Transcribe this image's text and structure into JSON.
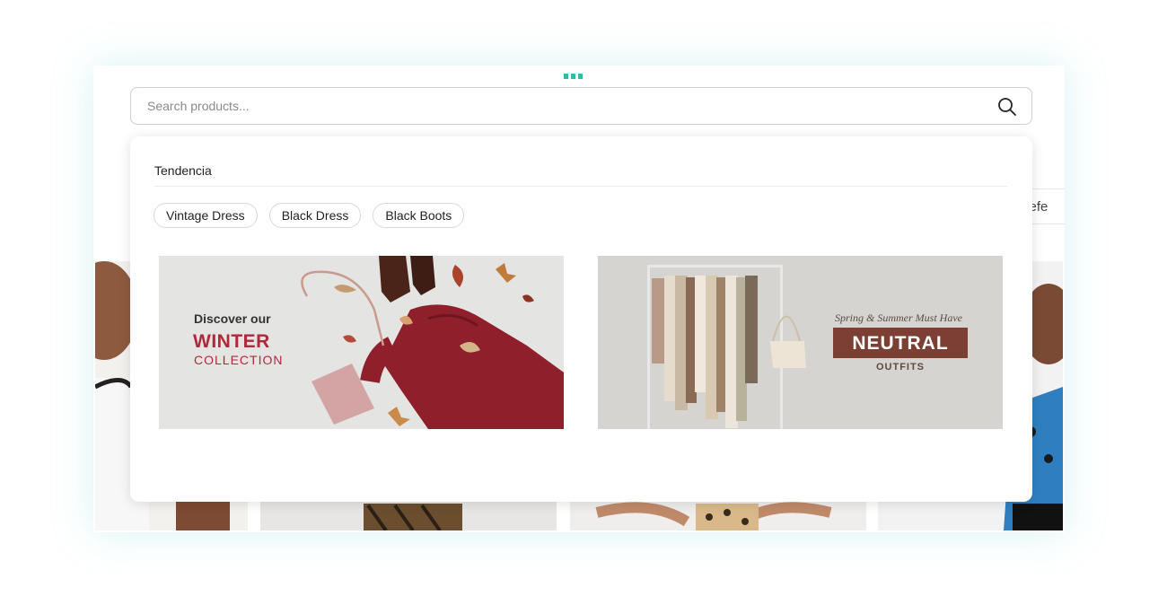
{
  "search": {
    "placeholder": "Search products...",
    "icon": "search-icon"
  },
  "sort": {
    "partial_label": "r defe"
  },
  "trending": {
    "title": "Tendencia",
    "chips": [
      "Vintage Dress",
      "Black Dress",
      "Black Boots"
    ]
  },
  "banners": {
    "winter": {
      "line1": "Discover our",
      "line2": "WINTER",
      "line3": "COLLECTION"
    },
    "neutral": {
      "line1": "Spring & Summer Must Have",
      "line2": "NEUTRAL",
      "line3": "OUTFITS"
    }
  },
  "colors": {
    "accent": "#2bbfa8",
    "winter_red": "#b0283a",
    "neutral_brown": "#7b3f33"
  }
}
